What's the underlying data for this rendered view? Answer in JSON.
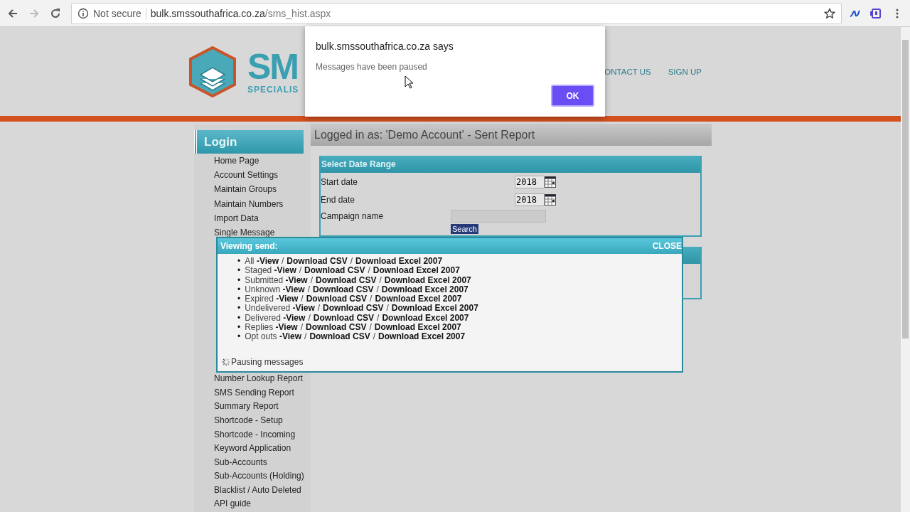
{
  "browser": {
    "security": "Not secure",
    "url_host": "bulk.smssouthafrica.co.za",
    "url_path": "/sms_hist.aspx"
  },
  "header": {
    "logo_word": "SM",
    "logo_tagline": "SPECIALIS",
    "nav": [
      "ONTACT US",
      "SIGN UP"
    ]
  },
  "sidebar": {
    "title": "Login",
    "items": [
      "Home Page",
      "Account Settings",
      "Maintain Groups",
      "Maintain Numbers",
      "Import Data",
      "Single Message"
    ],
    "items_below": [
      "Number Lookup Report",
      "SMS Sending Report",
      "Summary Report",
      "Shortcode - Setup",
      "Shortcode - Incoming",
      "Keyword Application",
      "Sub-Accounts",
      "Sub-Accounts (Holding)",
      "Blacklist / Auto Deleted",
      "API guide"
    ]
  },
  "main": {
    "title": "Logged in as: 'Demo Account' - Sent Report",
    "date_range": {
      "title": "Select Date Range",
      "start_label": "Start date",
      "start_value": "2018",
      "end_label": "End date",
      "end_value": "2018",
      "campaign_label": "Campaign name",
      "search": "Search"
    }
  },
  "popup": {
    "title": "Viewing send:",
    "close": "CLOSE",
    "separator": "/",
    "bullet": "•",
    "rows": [
      {
        "label": "All",
        "links": [
          "-View",
          "Download CSV",
          "Download Excel 2007"
        ]
      },
      {
        "label": "Staged",
        "links": [
          "-View",
          "Download CSV",
          "Download Excel 2007"
        ]
      },
      {
        "label": "Submitted",
        "links": [
          "-View",
          "Download CSV",
          "Download Excel 2007"
        ]
      },
      {
        "label": "Unknown",
        "links": [
          "-View",
          "Download CSV",
          "Download Excel 2007"
        ]
      },
      {
        "label": "Expired",
        "links": [
          "-View",
          "Download CSV",
          "Download Excel 2007"
        ]
      },
      {
        "label": "Undelivered",
        "links": [
          "-View",
          "Download CSV",
          "Download Excel 2007"
        ]
      },
      {
        "label": "Delivered",
        "links": [
          "-View",
          "Download CSV",
          "Download Excel 2007"
        ]
      },
      {
        "label": "Replies",
        "links": [
          "-View",
          "Download CSV",
          "Download Excel 2007"
        ]
      },
      {
        "label": "Opt outs",
        "links": [
          "-View",
          "Download CSV",
          "Download Excel 2007"
        ]
      }
    ],
    "status": "Pausing messages"
  },
  "alert": {
    "title": "bulk.smssouthafrica.co.za says",
    "message": "Messages have been paused",
    "ok": "OK"
  }
}
